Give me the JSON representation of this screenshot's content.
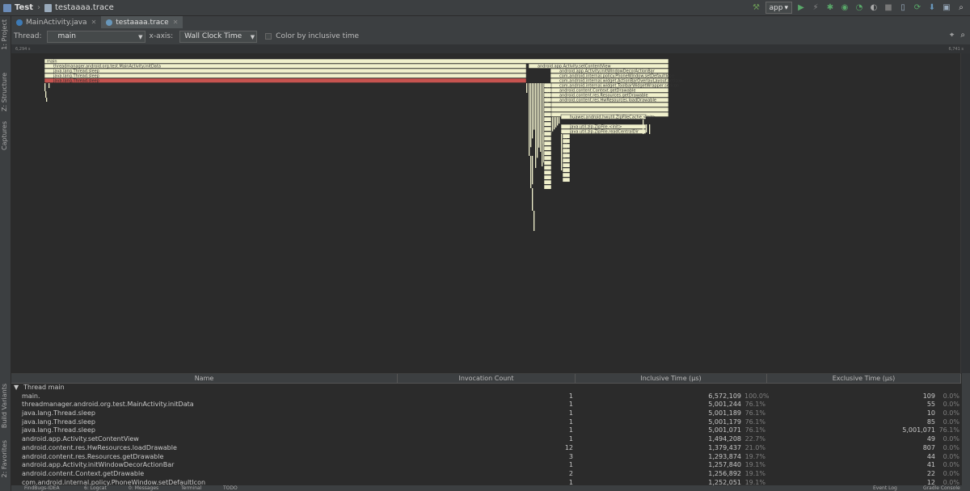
{
  "title_bar": {
    "project": "Test",
    "file": "testaaaa.trace",
    "run_config": "app"
  },
  "left_tabs": [
    "1: Project",
    "Z: Structure",
    "Captures",
    "Build Variants",
    "2: Favorites"
  ],
  "editor_tabs": [
    {
      "label": "MainActivity.java",
      "active": false
    },
    {
      "label": "testaaaa.trace",
      "active": true
    }
  ],
  "toolbar": {
    "thread_label": "Thread:",
    "thread_value": "main",
    "xaxis_label": "x-axis:",
    "xaxis_value": "Wall Clock Time",
    "color_label": "Color by inclusive time"
  },
  "ruler": {
    "start": "6,294 s",
    "end": "6,741 s"
  },
  "flame": {
    "labels": [
      "main",
      "threadmanager.android.org.test.MainActivity.initData",
      "android.app.Activity.setContentView",
      "java.lang.Thread.sleep",
      "java.lang.Thread.sleep",
      "java.lang.Thread.sleep",
      "android.app.Activity.initWindowDecorActionBar",
      "com.android.internal.policy.PhoneWindow.setDefaultIcon",
      "com.android.internal.widget.ActionBarOverlayLayout.setIcon",
      "com.android.internal.widget.ToolbarWidgetWrapper.setIcon",
      "android.content.Context.getDrawable",
      "android.content.res.Resources.getDrawable",
      "android.content.res.HwResources.loadDrawable",
      "huawei.android.hwutil.ZipFileCache.<init>",
      "java.util.zip.ZipFile.<init>",
      "java.util.zip.ZipFile.readCentralDir"
    ]
  },
  "table": {
    "headers": [
      "Name",
      "Invocation Count",
      "Inclusive Time (μs)",
      "Exclusive Time (μs)"
    ],
    "thread_row": "Thread main",
    "rows": [
      {
        "name": "main.",
        "count": "1",
        "incl": "6,572,109",
        "incl_pct": "100.0%",
        "excl": "109",
        "excl_pct": "0.0%"
      },
      {
        "name": "threadmanager.android.org.test.MainActivity.initData",
        "count": "1",
        "incl": "5,001,244",
        "incl_pct": "76.1%",
        "excl": "55",
        "excl_pct": "0.0%"
      },
      {
        "name": "java.lang.Thread.sleep",
        "count": "1",
        "incl": "5,001,189",
        "incl_pct": "76.1%",
        "excl": "10",
        "excl_pct": "0.0%"
      },
      {
        "name": "java.lang.Thread.sleep",
        "count": "1",
        "incl": "5,001,179",
        "incl_pct": "76.1%",
        "excl": "85",
        "excl_pct": "0.0%"
      },
      {
        "name": "java.lang.Thread.sleep",
        "count": "1",
        "incl": "5,001,071",
        "incl_pct": "76.1%",
        "excl": "5,001,071",
        "excl_pct": "76.1%"
      },
      {
        "name": "android.app.Activity.setContentView",
        "count": "1",
        "incl": "1,494,208",
        "incl_pct": "22.7%",
        "excl": "49",
        "excl_pct": "0.0%"
      },
      {
        "name": "android.content.res.HwResources.loadDrawable",
        "count": "12",
        "incl": "1,379,437",
        "incl_pct": "21.0%",
        "excl": "807",
        "excl_pct": "0.0%"
      },
      {
        "name": "android.content.res.Resources.getDrawable",
        "count": "3",
        "incl": "1,293,874",
        "incl_pct": "19.7%",
        "excl": "44",
        "excl_pct": "0.0%"
      },
      {
        "name": "android.app.Activity.initWindowDecorActionBar",
        "count": "1",
        "incl": "1,257,840",
        "incl_pct": "19.1%",
        "excl": "41",
        "excl_pct": "0.0%"
      },
      {
        "name": "android.content.Context.getDrawable",
        "count": "2",
        "incl": "1,256,892",
        "incl_pct": "19.1%",
        "excl": "22",
        "excl_pct": "0.0%"
      },
      {
        "name": "com.android.internal.policy.PhoneWindow.setDefaultIcon",
        "count": "1",
        "incl": "1,252,051",
        "incl_pct": "19.1%",
        "excl": "12",
        "excl_pct": "0.0%"
      }
    ]
  },
  "status_bar": [
    "FindBugs-IDEA",
    "6: Logcat",
    "0: Messages",
    "Terminal",
    "TODO",
    "Event Log",
    "Gradle Console"
  ],
  "colors": {
    "frame": "#f0f0cc",
    "highlight": "#c75450",
    "bg": "#2b2b2b"
  }
}
